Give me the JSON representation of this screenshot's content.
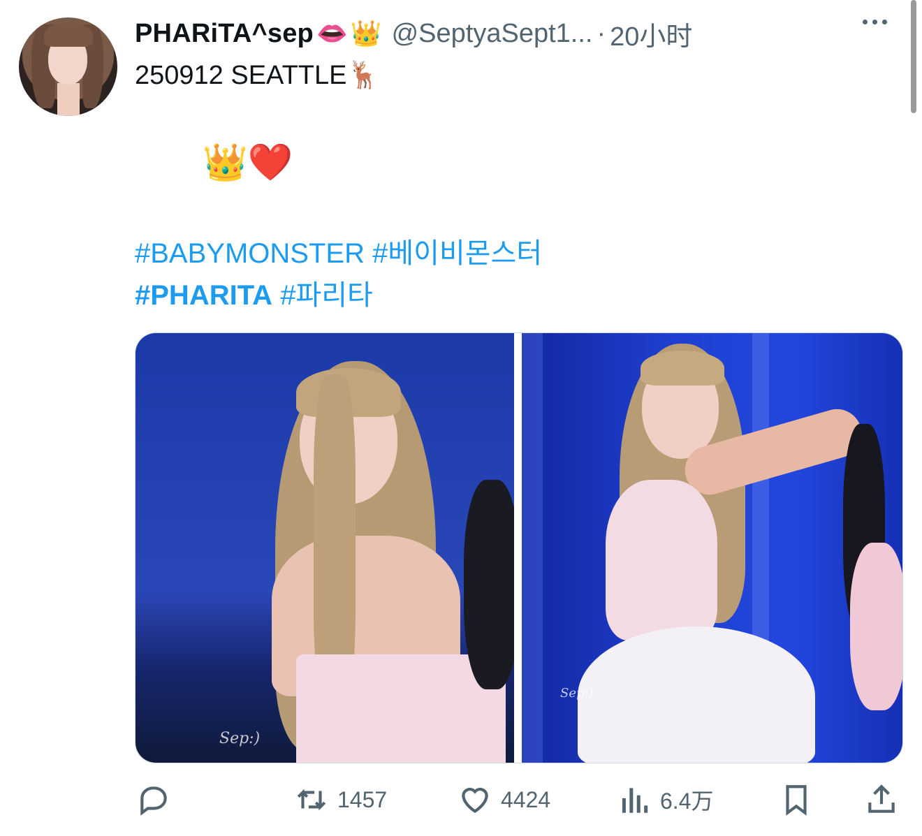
{
  "tweet": {
    "display_name": "PHARiTA^sep",
    "name_emojis": [
      "👄",
      "👑"
    ],
    "handle": "@SeptyaSept1...",
    "separator": "·",
    "time": "20小时",
    "text_line1": "250912 SEATTLE🦌",
    "emoji_line": "👑❤️",
    "hashtags_line1": [
      "#BABYMONSTER",
      "#베이비몬스터"
    ],
    "hashtags_line2": [
      {
        "text": "#PHARITA",
        "bold": true
      },
      {
        "text": "#파리타",
        "bold": false
      }
    ]
  },
  "media": {
    "photos": [
      {
        "watermark": "Sep:)"
      },
      {
        "watermark": "Sep:)"
      }
    ]
  },
  "actions": {
    "reply": {
      "icon": "reply-icon",
      "count": ""
    },
    "retweet": {
      "icon": "retweet-icon",
      "count": "1457"
    },
    "like": {
      "icon": "heart-icon",
      "count": "4424"
    },
    "views": {
      "icon": "views-icon",
      "count": "6.4万"
    },
    "bookmark": {
      "icon": "bookmark-icon",
      "count": ""
    },
    "share": {
      "icon": "share-icon",
      "count": ""
    }
  },
  "colors": {
    "link": "#1d9bf0",
    "secondary": "#536471",
    "primary": "#0f1419"
  }
}
